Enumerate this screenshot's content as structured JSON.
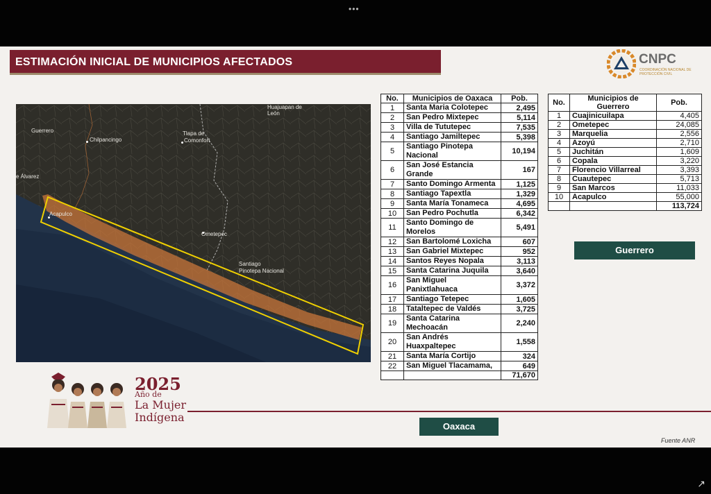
{
  "window": {
    "menu_dots": "•••"
  },
  "slide": {
    "title": "ESTIMACIÓN INICIAL DE MUNICIPIOS AFECTADOS",
    "logo": {
      "name": "CNPC",
      "subtitle": "COORDINACIÓN NACIONAL DE PROTECCIÓN CIVIL"
    },
    "source": "Fuente ANR",
    "annotation": {
      "year": "2025",
      "line1": "Año de",
      "line2": "La Mujer",
      "line3": "Indígena"
    }
  },
  "map": {
    "labels": {
      "guerrero": "Guerrero",
      "chilpancingo": "Chilpancingo",
      "alvarez": "e Álvarez",
      "acapulco": "Acapulco",
      "tlapa1": "Tlapa de",
      "tlapa2": "Comonfort",
      "huajuapan1": "Huajuapan de",
      "huajuapan2": "León",
      "ometepec": "Ometepec",
      "pinotepa1": "Santiago",
      "pinotepa2": "Pinotepa Nacional"
    }
  },
  "oaxaca": {
    "headers": {
      "no": "No.",
      "municipio": "Municipios de Oaxaca",
      "pob": "Pob."
    },
    "rows": [
      {
        "no": "1",
        "name": "Santa Maria Colotepec",
        "pob": "2,495"
      },
      {
        "no": "2",
        "name": "San Pedro Mixtepec",
        "pob": "5,114"
      },
      {
        "no": "3",
        "name": "Villa de Tututepec",
        "pob": "7,535"
      },
      {
        "no": "4",
        "name": "Santiago Jamiltepec",
        "pob": "5,398"
      },
      {
        "no": "5",
        "name": "Santiago Pinotepa Nacional",
        "pob": "10,194"
      },
      {
        "no": "6",
        "name": "San José Estancia Grande",
        "pob": "167"
      },
      {
        "no": "7",
        "name": "Santo Domingo Armenta",
        "pob": "1,125"
      },
      {
        "no": "8",
        "name": "Santiago Tapextla",
        "pob": "1,329"
      },
      {
        "no": "9",
        "name": "Santa María Tonameca",
        "pob": "4,695"
      },
      {
        "no": "10",
        "name": "San Pedro Pochutla",
        "pob": "6,342"
      },
      {
        "no": "11",
        "name": "Santo Domingo de Morelos",
        "pob": "5,491"
      },
      {
        "no": "12",
        "name": "San Bartolomé Loxicha",
        "pob": "607"
      },
      {
        "no": "13",
        "name": "San Gabriel Mixtepec",
        "pob": "952"
      },
      {
        "no": "14",
        "name": "Santos Reyes Nopala",
        "pob": "3,113"
      },
      {
        "no": "15",
        "name": "Santa Catarina Juquila",
        "pob": "3,640"
      },
      {
        "no": "16",
        "name": "San Miguel Panixtlahuaca",
        "pob": "3,372"
      },
      {
        "no": "17",
        "name": "Santiago Tetepec",
        "pob": "1,605"
      },
      {
        "no": "18",
        "name": "Tataltepec de Valdés",
        "pob": "3,725"
      },
      {
        "no": "19",
        "name": "Santa Catarina Mechoacán",
        "pob": "2,240"
      },
      {
        "no": "20",
        "name": "San Andrés Huaxpaltepec",
        "pob": "1,558"
      },
      {
        "no": "21",
        "name": "Santa María Cortijo",
        "pob": "324"
      },
      {
        "no": "22",
        "name": "San Miguel Tlacamama,",
        "pob": "649"
      }
    ],
    "total": "71,670",
    "tag": "Oaxaca"
  },
  "guerrero": {
    "headers": {
      "no": "No.",
      "municipio": "Municipios de Guerrero",
      "pob": "Pob."
    },
    "rows": [
      {
        "no": "1",
        "name": "Cuajinicuilapa",
        "pob": "4,405"
      },
      {
        "no": "2",
        "name": "Ometepec",
        "pob": "24,085"
      },
      {
        "no": "3",
        "name": "Marquelia",
        "pob": "2,556"
      },
      {
        "no": "4",
        "name": "Azoyú",
        "pob": "2,710"
      },
      {
        "no": "5",
        "name": "Juchitán",
        "pob": "1,609"
      },
      {
        "no": "6",
        "name": "Copala",
        "pob": "3,220"
      },
      {
        "no": "7",
        "name": "Florencio Villarreal",
        "pob": "3,393"
      },
      {
        "no": "8",
        "name": "Cuautepec",
        "pob": "5,713"
      },
      {
        "no": "9",
        "name": "San Marcos",
        "pob": "11,033"
      },
      {
        "no": "10",
        "name": "Acapulco",
        "pob": "55,000"
      }
    ],
    "total": "113,724",
    "tag": "Guerrero"
  },
  "colors": {
    "title_bg": "#7a1f2e",
    "tag_bg": "#1f4d45",
    "highlight": "#f0d000",
    "zone": "#c8763a"
  }
}
